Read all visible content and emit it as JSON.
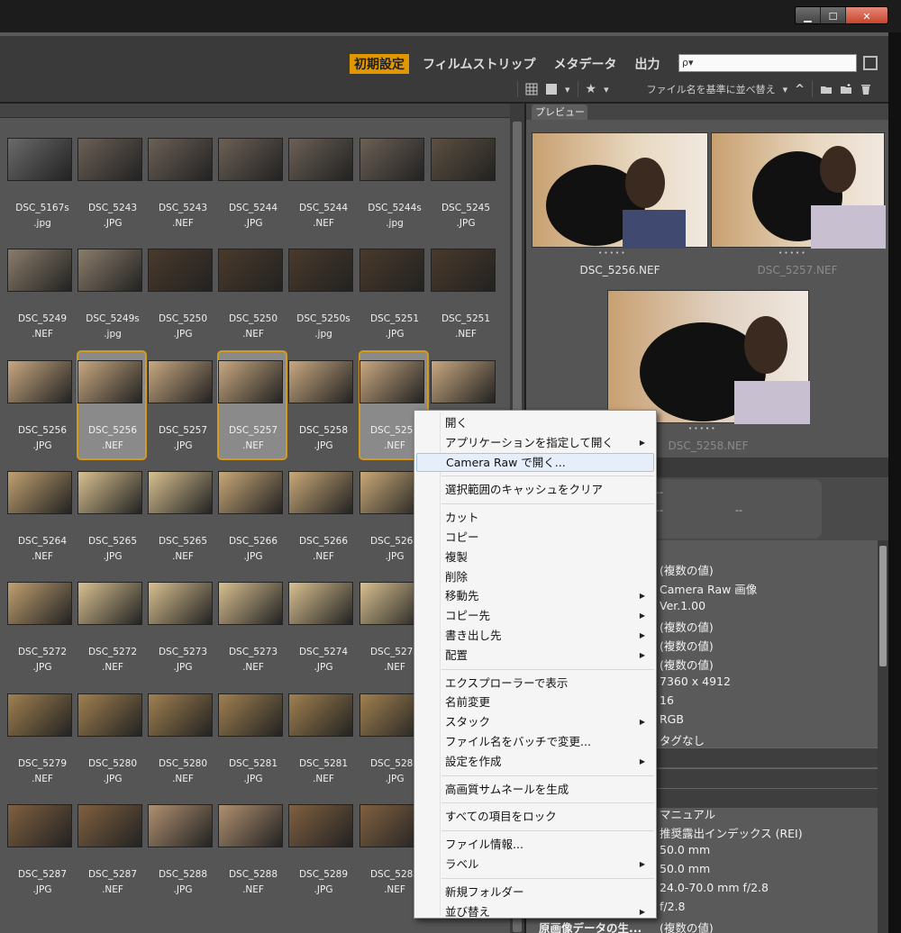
{
  "window": {
    "minimize": "▁",
    "maximize": "☐",
    "close": "✕"
  },
  "toolbar": {
    "workspaces": [
      {
        "label": "初期設定",
        "active": true
      },
      {
        "label": "フィルムストリップ",
        "active": false
      },
      {
        "label": "メタデータ",
        "active": false
      },
      {
        "label": "出力",
        "active": false
      }
    ],
    "output_caret": "▼",
    "search_placeholder": "ρ▾",
    "sort_label": "ファイル名を基準に並べ替え",
    "sort_caret": "▾",
    "sort_dir": "^",
    "rating_star": "★"
  },
  "thumbnails": [
    {
      "name": "DSC_5167s",
      "ext": ".jpg",
      "tone": "#6a6a6a"
    },
    {
      "name": "DSC_5243",
      "ext": ".JPG",
      "tone": "#6b6055"
    },
    {
      "name": "DSC_5243",
      "ext": ".NEF",
      "tone": "#6b6055"
    },
    {
      "name": "DSC_5244",
      "ext": ".JPG",
      "tone": "#6b6055"
    },
    {
      "name": "DSC_5244",
      "ext": ".NEF",
      "tone": "#6b6055"
    },
    {
      "name": "DSC_5244s",
      "ext": ".jpg",
      "tone": "#6b6055"
    },
    {
      "name": "DSC_5245",
      "ext": ".JPG",
      "tone": "#5c5040"
    },
    {
      "name": "DSC_5249",
      "ext": ".NEF",
      "tone": "#8a7c6a"
    },
    {
      "name": "DSC_5249s",
      "ext": ".jpg",
      "tone": "#8a7c6a"
    },
    {
      "name": "DSC_5250",
      "ext": ".JPG",
      "tone": "#4a3a2a"
    },
    {
      "name": "DSC_5250",
      "ext": ".NEF",
      "tone": "#4a3a2a"
    },
    {
      "name": "DSC_5250s",
      "ext": ".jpg",
      "tone": "#4a3a2a"
    },
    {
      "name": "DSC_5251",
      "ext": ".JPG",
      "tone": "#4a3a2a"
    },
    {
      "name": "DSC_5251",
      "ext": ".NEF",
      "tone": "#4a3a2a"
    },
    {
      "name": "DSC_5256",
      "ext": ".JPG",
      "tone": "#c8a880"
    },
    {
      "name": "DSC_5256",
      "ext": ".NEF",
      "tone": "#c8a880",
      "selected": true
    },
    {
      "name": "DSC_5257",
      "ext": ".JPG",
      "tone": "#c8a880"
    },
    {
      "name": "DSC_5257",
      "ext": ".NEF",
      "tone": "#c8a880",
      "selected": true
    },
    {
      "name": "DSC_5258",
      "ext": ".JPG",
      "tone": "#c8a880"
    },
    {
      "name": "DSC_5258",
      "ext": ".NEF",
      "tone": "#c8a880",
      "selected": true
    },
    {
      "name": "",
      "ext": "",
      "tone": "#c8a880"
    },
    {
      "name": "DSC_5264",
      "ext": ".NEF",
      "tone": "#c0a070"
    },
    {
      "name": "DSC_5265",
      "ext": ".JPG",
      "tone": "#d8c090"
    },
    {
      "name": "DSC_5265",
      "ext": ".NEF",
      "tone": "#d8c090"
    },
    {
      "name": "DSC_5266",
      "ext": ".JPG",
      "tone": "#c8a878"
    },
    {
      "name": "DSC_5266",
      "ext": ".NEF",
      "tone": "#c8a878"
    },
    {
      "name": "DSC_5267",
      "ext": ".JPG",
      "tone": "#c8a878"
    },
    {
      "name": "",
      "ext": "",
      "tone": "#555"
    },
    {
      "name": "DSC_5272",
      "ext": ".JPG",
      "tone": "#c0a070"
    },
    {
      "name": "DSC_5272",
      "ext": ".NEF",
      "tone": "#d8c090"
    },
    {
      "name": "DSC_5273",
      "ext": ".JPG",
      "tone": "#d8c090"
    },
    {
      "name": "DSC_5273",
      "ext": ".NEF",
      "tone": "#d8c090"
    },
    {
      "name": "DSC_5274",
      "ext": ".JPG",
      "tone": "#d8c090"
    },
    {
      "name": "DSC_5274",
      "ext": ".NEF",
      "tone": "#d8c090"
    },
    {
      "name": "",
      "ext": "",
      "tone": "#555"
    },
    {
      "name": "DSC_5279",
      "ext": ".NEF",
      "tone": "#a08050"
    },
    {
      "name": "DSC_5280",
      "ext": ".JPG",
      "tone": "#a08050"
    },
    {
      "name": "DSC_5280",
      "ext": ".NEF",
      "tone": "#a08050"
    },
    {
      "name": "DSC_5281",
      "ext": ".JPG",
      "tone": "#a08050"
    },
    {
      "name": "DSC_5281",
      "ext": ".NEF",
      "tone": "#a08050"
    },
    {
      "name": "DSC_5282",
      "ext": ".JPG",
      "tone": "#a08050"
    },
    {
      "name": "",
      "ext": "",
      "tone": "#555"
    },
    {
      "name": "DSC_5287",
      "ext": ".JPG",
      "tone": "#806040"
    },
    {
      "name": "DSC_5287",
      "ext": ".NEF",
      "tone": "#806040"
    },
    {
      "name": "DSC_5288",
      "ext": ".JPG",
      "tone": "#b09070"
    },
    {
      "name": "DSC_5288",
      "ext": ".NEF",
      "tone": "#b09070"
    },
    {
      "name": "DSC_5289",
      "ext": ".JPG",
      "tone": "#806040"
    },
    {
      "name": "DSC_5289",
      "ext": ".NEF",
      "tone": "#806040"
    },
    {
      "name": "",
      "ext": "",
      "tone": "#555"
    }
  ],
  "preview": {
    "tab": "プレビュー",
    "items": [
      "DSC_5256.NEF",
      "DSC_5257.NEF",
      "DSC_5258.NEF"
    ],
    "dots": "• • • • •"
  },
  "metadata": {
    "box": [
      "--",
      "--",
      "--"
    ],
    "rows1": [
      "(複数の値)",
      "Camera Raw 画像",
      "Ver.1.00",
      "(複数の値)",
      "(複数の値)",
      "(複数の値)",
      "7360 x 4912",
      "16",
      "RGB",
      "タグなし"
    ],
    "rows2": [
      "マニュアル",
      "推奨露出インデックス (REI)",
      "50.0 mm",
      "50.0 mm",
      "24.0-70.0 mm f/2.8",
      "f/2.8"
    ],
    "last_label": "原画像データの生...",
    "last_value": "(複数の値)"
  },
  "context_menu": {
    "items": [
      {
        "label": "開く",
        "sub": false
      },
      {
        "label": "アプリケーションを指定して開く",
        "sub": true
      },
      {
        "label": "Camera Raw で開く...",
        "sub": false,
        "highlight": true
      },
      {
        "sep": true
      },
      {
        "label": "選択範囲のキャッシュをクリア",
        "sub": false
      },
      {
        "sep": true
      },
      {
        "label": "カット",
        "sub": false
      },
      {
        "label": "コピー",
        "sub": false
      },
      {
        "label": "複製",
        "sub": false
      },
      {
        "label": "削除",
        "sub": false
      },
      {
        "label": "移動先",
        "sub": true
      },
      {
        "label": "コピー先",
        "sub": true
      },
      {
        "label": "書き出し先",
        "sub": true
      },
      {
        "label": "配置",
        "sub": true
      },
      {
        "sep": true
      },
      {
        "label": "エクスプローラーで表示",
        "sub": false
      },
      {
        "label": "名前変更",
        "sub": false
      },
      {
        "label": "スタック",
        "sub": true
      },
      {
        "label": "ファイル名をバッチで変更...",
        "sub": false
      },
      {
        "label": "設定を作成",
        "sub": true
      },
      {
        "sep": true
      },
      {
        "label": "高画質サムネールを生成",
        "sub": false
      },
      {
        "sep": true
      },
      {
        "label": "すべての項目をロック",
        "sub": false
      },
      {
        "sep": true
      },
      {
        "label": "ファイル情報...",
        "sub": false
      },
      {
        "label": "ラベル",
        "sub": true
      },
      {
        "sep": true
      },
      {
        "label": "新規フォルダー",
        "sub": false
      },
      {
        "label": "並び替え",
        "sub": true
      }
    ],
    "submenu_arrow": "▶"
  }
}
